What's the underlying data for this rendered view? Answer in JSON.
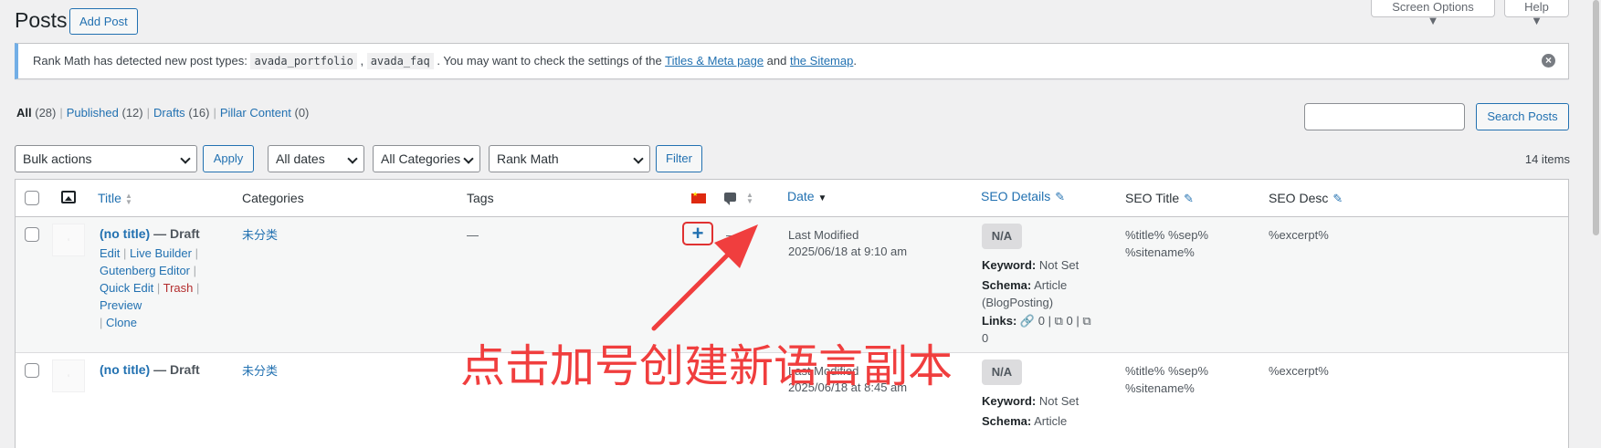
{
  "header": {
    "title": "Posts",
    "add_post_label": "Add Post",
    "screen_options_label": "Screen Options",
    "help_label": "Help"
  },
  "notice": {
    "text_before": "Rank Math has detected new post types: ",
    "code1": "avada_portfolio",
    "comma": " , ",
    "code2": "avada_faq",
    "text_mid": " . You may want to check the settings of the ",
    "link1": "Titles & Meta page",
    "and": " and ",
    "link2": "the Sitemap",
    "end": "."
  },
  "views": [
    {
      "label": "All",
      "count": "(28)"
    },
    {
      "label": "Published",
      "count": "(12)"
    },
    {
      "label": "Drafts",
      "count": "(16)"
    },
    {
      "label": "Pillar Content",
      "count": "(0)"
    }
  ],
  "search": {
    "button_label": "Search Posts"
  },
  "filters": {
    "bulk_actions": "Bulk actions",
    "apply_label": "Apply",
    "dates": "All dates",
    "categories": "All Categories",
    "rank_math": "Rank Math",
    "filter_label": "Filter",
    "items_count": "14 items"
  },
  "columns": {
    "title": "Title",
    "categories": "Categories",
    "tags": "Tags",
    "date": "Date",
    "seo_details": "SEO Details",
    "seo_title": "SEO Title",
    "seo_desc": "SEO Desc"
  },
  "rows": [
    {
      "title": "(no title)",
      "state": " — Draft",
      "actions": {
        "edit": "Edit",
        "live_builder": "Live Builder",
        "gutenberg": "Gutenberg Editor",
        "quick_edit": "Quick Edit",
        "trash": "Trash",
        "preview": "Preview",
        "clone": "Clone"
      },
      "category": "未分类",
      "tags": "—",
      "comments": "—",
      "date_label": "Last Modified",
      "date_value": "2025/06/18 at 9:10 am",
      "score": "N/A",
      "keyword_label": "Keyword:",
      "keyword_value": " Not Set",
      "schema_label": "Schema:",
      "schema_value": " Article",
      "schema_value2": "(BlogPosting)",
      "links_label": "Links:",
      "links_internal": "0",
      "links_external": "0",
      "links_incoming": "0",
      "seo_title_1": "%title% %sep%",
      "seo_title_2": "%sitename%",
      "seo_desc": "%excerpt%",
      "add_translation": "+"
    },
    {
      "title": "(no title)",
      "state": " — Draft",
      "category": "未分类",
      "date_label": "Last Modified",
      "date_value": "2025/06/18 at 8:45 am",
      "score": "N/A",
      "keyword_label": "Keyword:",
      "keyword_value": " Not Set",
      "schema_label": "Schema:",
      "schema_value": " Article",
      "seo_title_1": "%title% %sep%",
      "seo_title_2": "%sitename%",
      "seo_desc": "%excerpt%"
    }
  ],
  "annotation": {
    "text": "点击加号创建新语言副本",
    "color": "#f03e3e"
  },
  "icons": {
    "image_column": "image-icon",
    "language_flag": "china-flag-icon",
    "comments": "comment-bubble-icon",
    "edit": "pencil-icon",
    "dismiss": "close-circle-icon"
  }
}
